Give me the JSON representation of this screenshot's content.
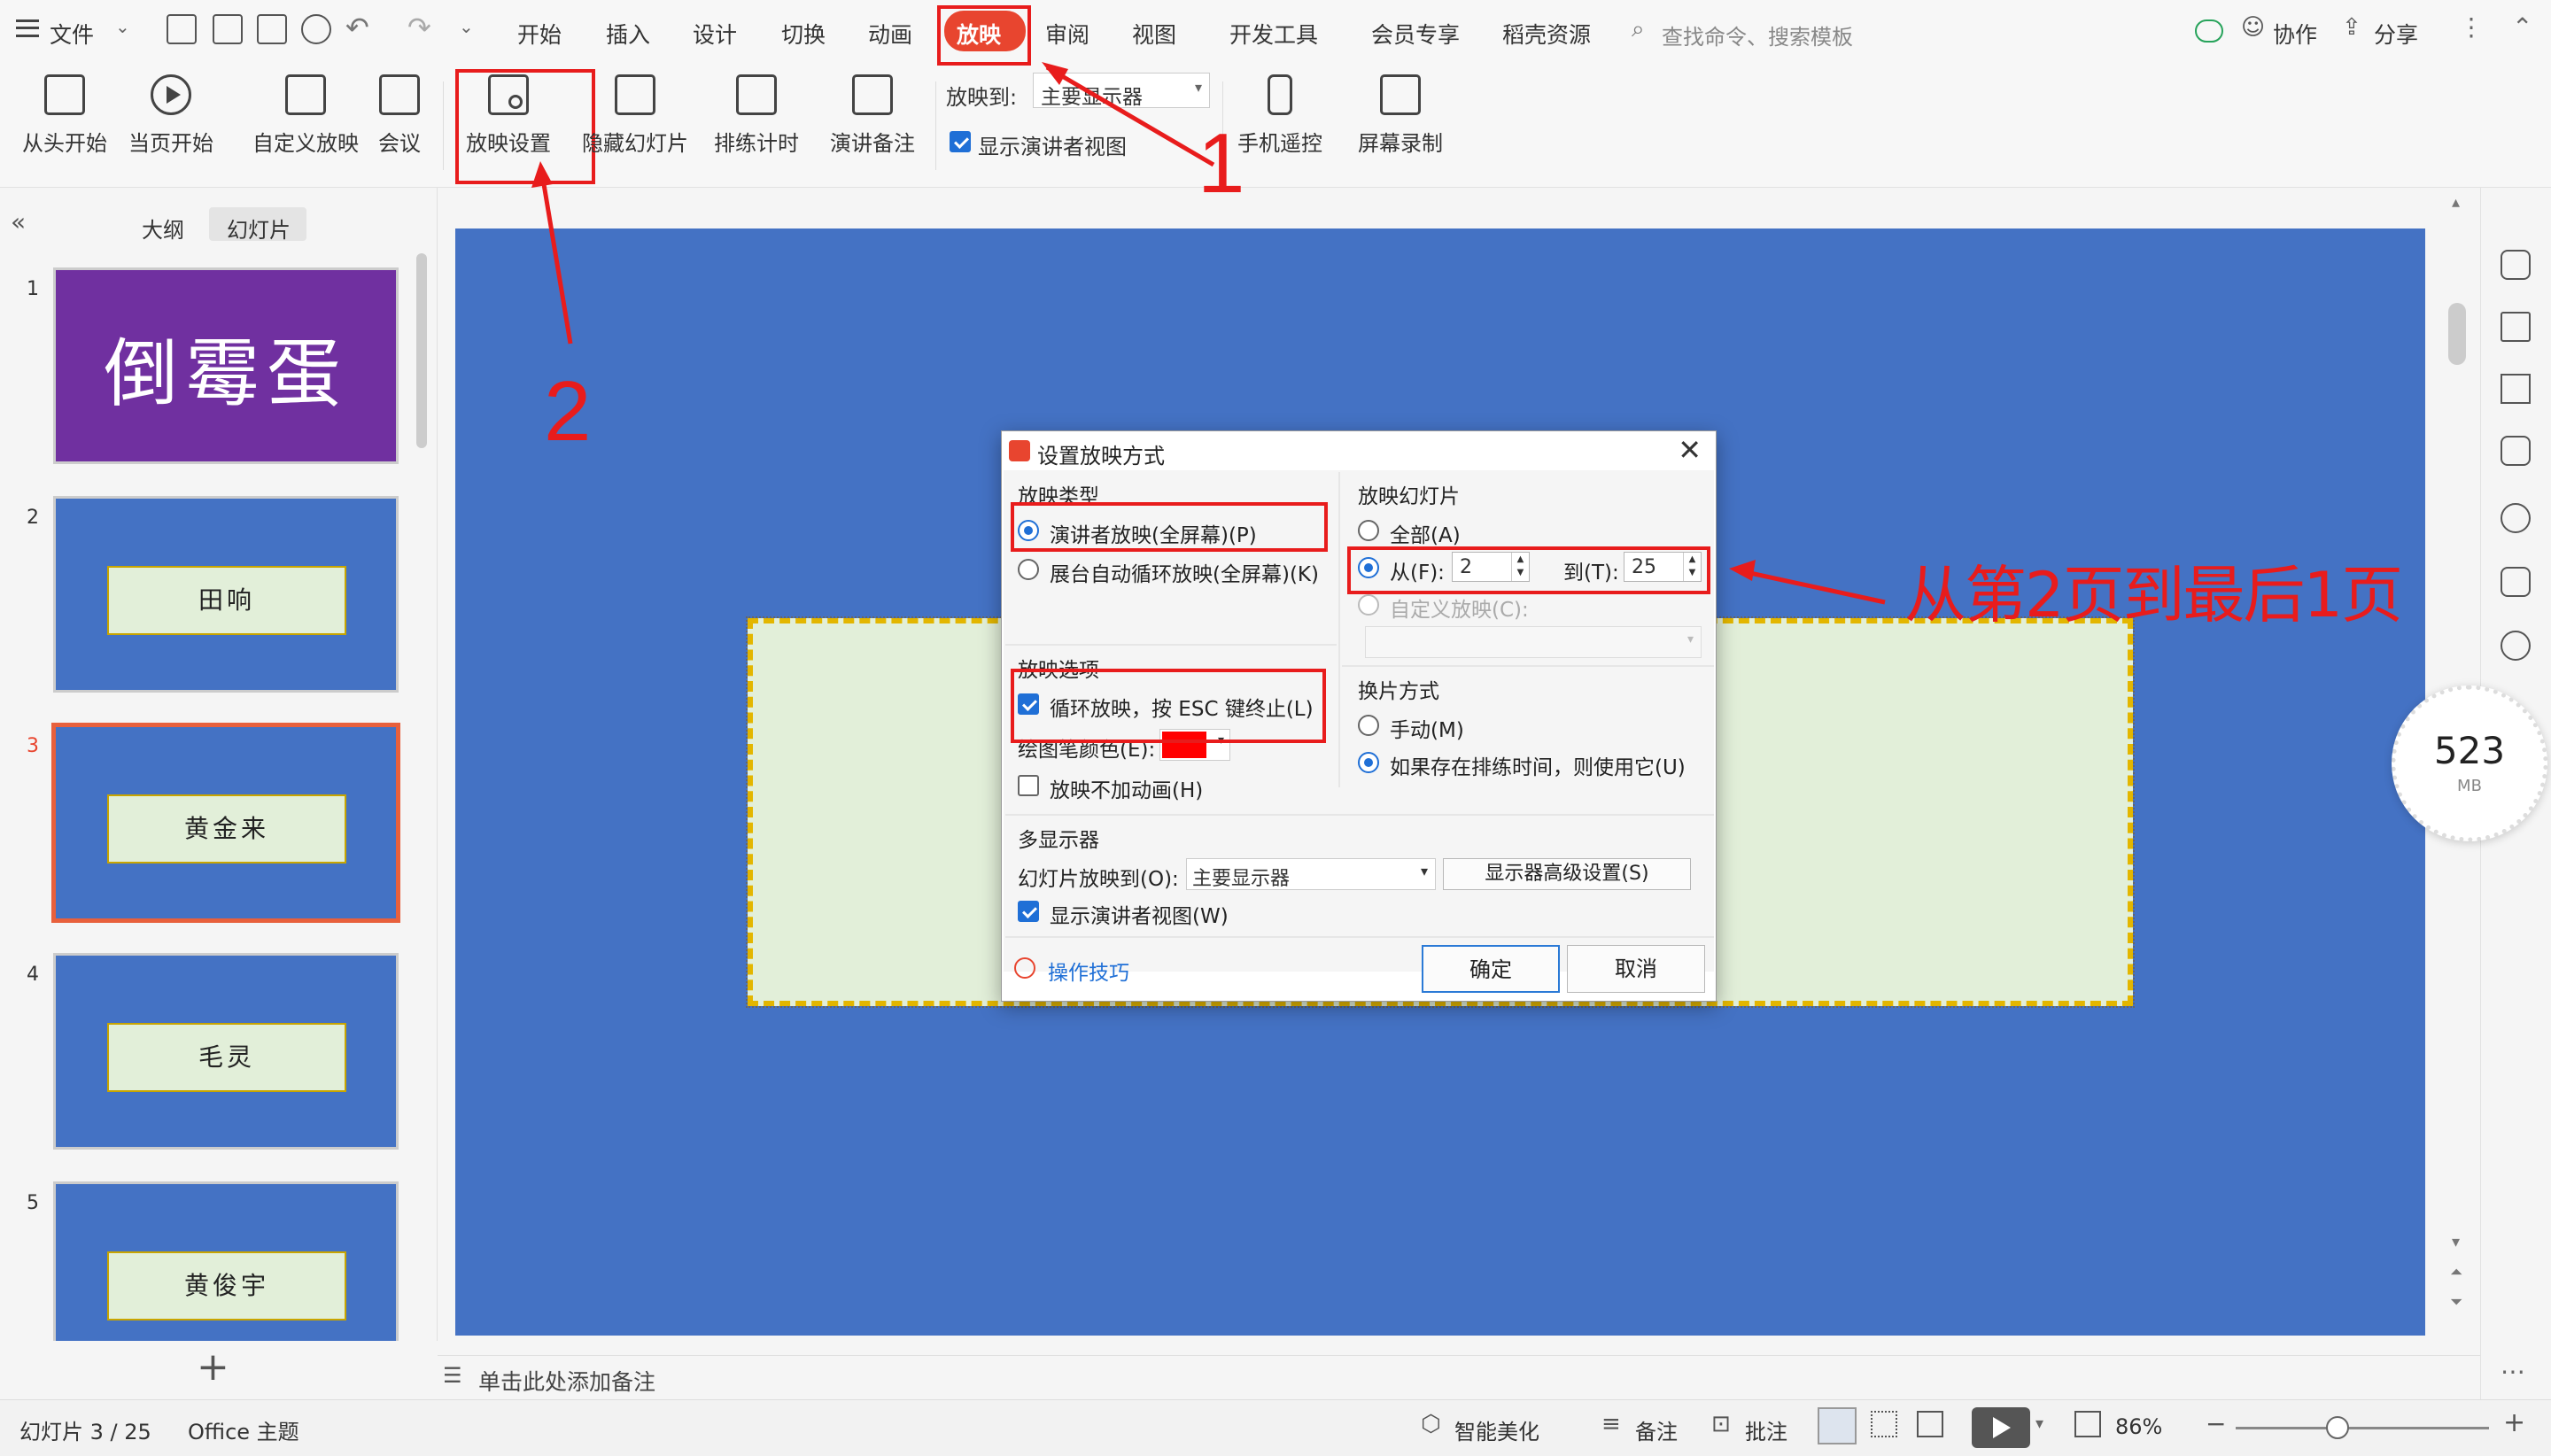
{
  "menubar": {
    "file": "文件",
    "tabs": [
      "开始",
      "插入",
      "设计",
      "切换",
      "动画",
      "放映",
      "审阅",
      "视图",
      "开发工具",
      "会员专享",
      "稻壳资源"
    ],
    "active_tab": "放映",
    "search_placeholder": "查找命令、搜索模板",
    "collab": "协作",
    "share": "分享"
  },
  "ribbon": {
    "buttons": [
      "从头开始",
      "当页开始",
      "自定义放映",
      "会议",
      "放映设置",
      "隐藏幻灯片",
      "排练计时",
      "演讲备注",
      "手机遥控",
      "屏幕录制"
    ],
    "play_to_label": "放映到:",
    "play_to_value": "主要显示器",
    "presenter_view": "显示演讲者视图"
  },
  "leftpanel": {
    "tab_outline": "大纲",
    "tab_slides": "幻灯片",
    "slides": [
      {
        "num": "1",
        "text": "倒霉蛋"
      },
      {
        "num": "2",
        "text": "田响"
      },
      {
        "num": "3",
        "text": "黄金来"
      },
      {
        "num": "4",
        "text": "毛灵"
      },
      {
        "num": "5",
        "text": "黄俊宇"
      }
    ],
    "add": "+"
  },
  "dialog": {
    "title": "设置放映方式",
    "show_type_title": "放映类型",
    "show_type_presenter": "演讲者放映(全屏幕)(P)",
    "show_type_kiosk": "展台自动循环放映(全屏幕)(K)",
    "slides_title": "放映幻灯片",
    "slides_all": "全部(A)",
    "slides_from": "从(F):",
    "from_value": "2",
    "slides_to": "到(T):",
    "to_value": "25",
    "custom_show": "自定义放映(C):",
    "options_title": "放映选项",
    "loop": "循环放映，按 ESC 键终止(L)",
    "pen_color": "绘图笔颜色(E):",
    "pen_color_value": "#ff0000",
    "no_animation": "放映不加动画(H)",
    "advance_title": "换片方式",
    "advance_manual": "手动(M)",
    "advance_timing": "如果存在排练时间，则使用它(U)",
    "multi_title": "多显示器",
    "slide_show_on": "幻灯片放映到(O):",
    "monitor_value": "主要显示器",
    "advanced_button": "显示器高级设置(S)",
    "presenter_view": "显示演讲者视图(W)",
    "tips": "操作技巧",
    "ok": "确定",
    "cancel": "取消"
  },
  "annotations": {
    "label1": "1",
    "label2": "2",
    "callout": "从第2页到最后1页",
    "color": "#e81c1c"
  },
  "notes": {
    "placeholder": "单击此处添加备注"
  },
  "memory": {
    "value": "523",
    "unit": "MB"
  },
  "statusbar": {
    "slide_info": "幻灯片 3 / 25",
    "theme": "Office 主题",
    "beautify": "智能美化",
    "notes": "备注",
    "comments": "批注",
    "zoom": "86%"
  }
}
